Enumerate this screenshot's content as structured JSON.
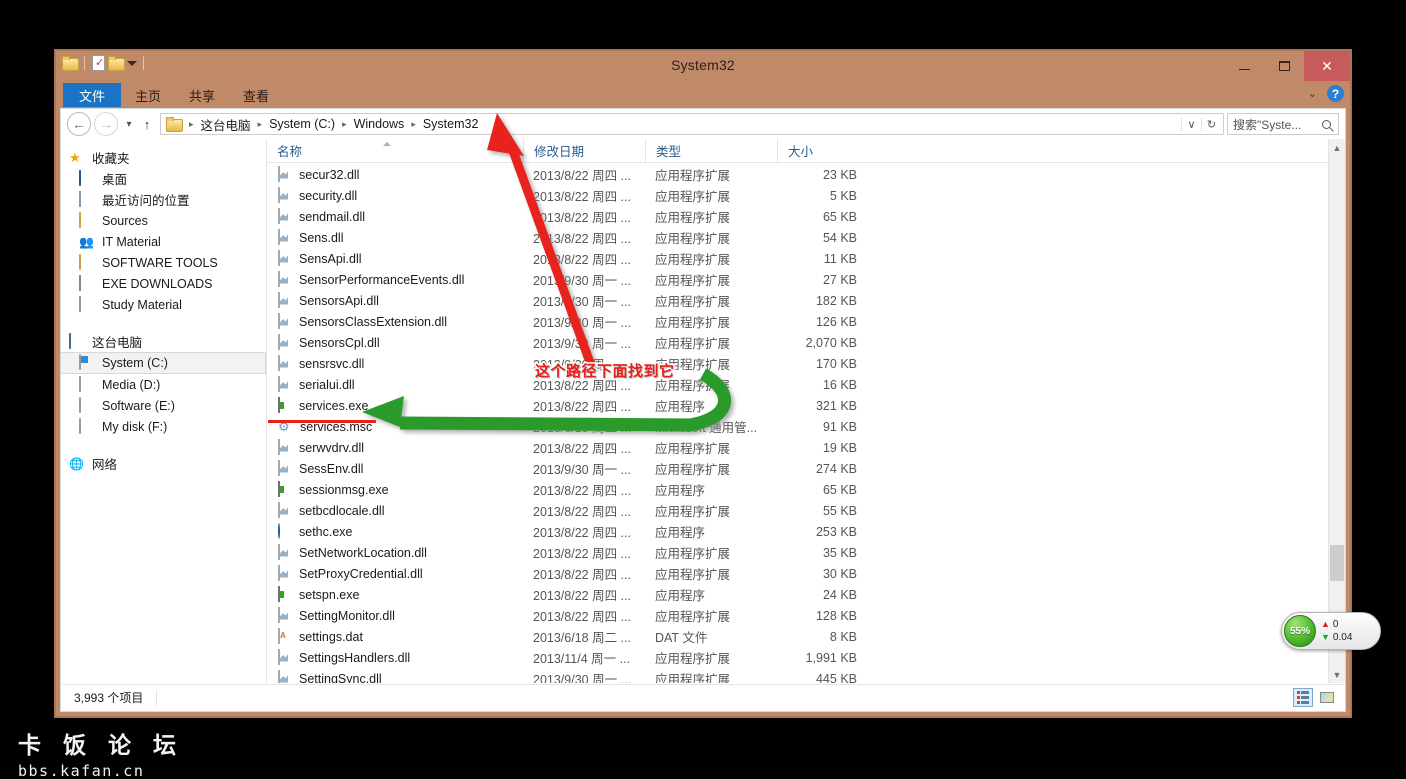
{
  "window": {
    "title": "System32",
    "quick_access": [
      "folder-icon",
      "properties-icon",
      "new-folder-icon",
      "customize-chevron-icon"
    ],
    "controls": {
      "minimize": "minimize-icon",
      "maximize": "maximize-icon",
      "close": "✕"
    }
  },
  "ribbon": {
    "tabs": [
      {
        "label": "文件",
        "active": true
      },
      {
        "label": "主页",
        "active": false
      },
      {
        "label": "共享",
        "active": false
      },
      {
        "label": "查看",
        "active": false
      }
    ],
    "collapse_icon": "chevron-down-icon",
    "help_icon": "?"
  },
  "address": {
    "back": "←",
    "forward": "→",
    "recent": "▾",
    "up": "↑",
    "breadcrumbs": [
      "这台电脑",
      "System (C:)",
      "Windows",
      "System32"
    ],
    "separator": "▸",
    "dropdown": "∨",
    "refresh": "↻",
    "search_value": "搜索\"Syste...",
    "search_placeholder": "搜索\"System32\""
  },
  "sidebar": {
    "groups": [
      {
        "header": {
          "label": "收藏夹",
          "icon": "star-icon"
        },
        "items": [
          {
            "label": "桌面",
            "icon": "desktop-icon",
            "selected": false
          },
          {
            "label": "最近访问的位置",
            "icon": "recent-places-icon",
            "selected": false
          },
          {
            "label": "Sources",
            "icon": "folder-icon",
            "selected": false
          },
          {
            "label": "IT Material",
            "icon": "shared-folder-icon",
            "selected": false
          },
          {
            "label": "SOFTWARE TOOLS",
            "icon": "folder-icon",
            "selected": false
          },
          {
            "label": "EXE DOWNLOADS",
            "icon": "exe-folder-icon",
            "selected": false
          },
          {
            "label": "Study Material",
            "icon": "document-icon",
            "selected": false
          }
        ]
      },
      {
        "header": {
          "label": "这台电脑",
          "icon": "computer-icon"
        },
        "items": [
          {
            "label": "System (C:)",
            "icon": "system-drive-icon",
            "selected": true
          },
          {
            "label": "Media (D:)",
            "icon": "drive-icon",
            "selected": false
          },
          {
            "label": "Software (E:)",
            "icon": "drive-icon",
            "selected": false
          },
          {
            "label": "My disk (F:)",
            "icon": "drive-icon",
            "selected": false
          }
        ]
      },
      {
        "header": {
          "label": "网络",
          "icon": "network-icon"
        },
        "items": []
      }
    ]
  },
  "filelist": {
    "columns": [
      {
        "label": "名称",
        "sorted": "asc"
      },
      {
        "label": "修改日期",
        "sorted": ""
      },
      {
        "label": "类型",
        "sorted": ""
      },
      {
        "label": "大小",
        "sorted": ""
      }
    ],
    "rows": [
      {
        "name": "secur32.dll",
        "date": "2013/8/22 周四 ...",
        "type": "应用程序扩展",
        "size": "23 KB",
        "icon": "dll-icon"
      },
      {
        "name": "security.dll",
        "date": "2013/8/22 周四 ...",
        "type": "应用程序扩展",
        "size": "5 KB",
        "icon": "dll-icon"
      },
      {
        "name": "sendmail.dll",
        "date": "2013/8/22 周四 ...",
        "type": "应用程序扩展",
        "size": "65 KB",
        "icon": "dll-icon"
      },
      {
        "name": "Sens.dll",
        "date": "2013/8/22 周四 ...",
        "type": "应用程序扩展",
        "size": "54 KB",
        "icon": "dll-icon"
      },
      {
        "name": "SensApi.dll",
        "date": "2013/8/22 周四 ...",
        "type": "应用程序扩展",
        "size": "11 KB",
        "icon": "dll-icon"
      },
      {
        "name": "SensorPerformanceEvents.dll",
        "date": "2013/9/30 周一 ...",
        "type": "应用程序扩展",
        "size": "27 KB",
        "icon": "dll-icon"
      },
      {
        "name": "SensorsApi.dll",
        "date": "2013/9/30 周一 ...",
        "type": "应用程序扩展",
        "size": "182 KB",
        "icon": "dll-icon"
      },
      {
        "name": "SensorsClassExtension.dll",
        "date": "2013/9/30 周一 ...",
        "type": "应用程序扩展",
        "size": "126 KB",
        "icon": "dll-icon"
      },
      {
        "name": "SensorsCpl.dll",
        "date": "2013/9/30 周一 ...",
        "type": "应用程序扩展",
        "size": "2,070 KB",
        "icon": "dll-icon"
      },
      {
        "name": "sensrsvc.dll",
        "date": "2013/9/30 周一 ...",
        "type": "应用程序扩展",
        "size": "170 KB",
        "icon": "dll-icon"
      },
      {
        "name": "serialui.dll",
        "date": "2013/8/22 周四 ...",
        "type": "应用程序扩展",
        "size": "16 KB",
        "icon": "dll-icon"
      },
      {
        "name": "services.exe",
        "date": "2013/8/22 周四 ...",
        "type": "应用程序",
        "size": "321 KB",
        "icon": "exe-icon"
      },
      {
        "name": "services.msc",
        "date": "2013/6/18 周二 ...",
        "type": "Microsoft 通用管...",
        "size": "91 KB",
        "icon": "msc-icon"
      },
      {
        "name": "serwvdrv.dll",
        "date": "2013/8/22 周四 ...",
        "type": "应用程序扩展",
        "size": "19 KB",
        "icon": "dll-icon"
      },
      {
        "name": "SessEnv.dll",
        "date": "2013/9/30 周一 ...",
        "type": "应用程序扩展",
        "size": "274 KB",
        "icon": "dll-icon"
      },
      {
        "name": "sessionmsg.exe",
        "date": "2013/8/22 周四 ...",
        "type": "应用程序",
        "size": "65 KB",
        "icon": "exe-icon"
      },
      {
        "name": "setbcdlocale.dll",
        "date": "2013/8/22 周四 ...",
        "type": "应用程序扩展",
        "size": "55 KB",
        "icon": "dll-icon"
      },
      {
        "name": "sethc.exe",
        "date": "2013/8/22 周四 ...",
        "type": "应用程序",
        "size": "253 KB",
        "icon": "sethc-icon"
      },
      {
        "name": "SetNetworkLocation.dll",
        "date": "2013/8/22 周四 ...",
        "type": "应用程序扩展",
        "size": "35 KB",
        "icon": "dll-icon"
      },
      {
        "name": "SetProxyCredential.dll",
        "date": "2013/8/22 周四 ...",
        "type": "应用程序扩展",
        "size": "30 KB",
        "icon": "dll-icon"
      },
      {
        "name": "setspn.exe",
        "date": "2013/8/22 周四 ...",
        "type": "应用程序",
        "size": "24 KB",
        "icon": "exe-icon"
      },
      {
        "name": "SettingMonitor.dll",
        "date": "2013/8/22 周四 ...",
        "type": "应用程序扩展",
        "size": "128 KB",
        "icon": "dll-icon"
      },
      {
        "name": "settings.dat",
        "date": "2013/6/18 周二 ...",
        "type": "DAT 文件",
        "size": "8 KB",
        "icon": "dat-icon"
      },
      {
        "name": "SettingsHandlers.dll",
        "date": "2013/11/4 周一 ...",
        "type": "应用程序扩展",
        "size": "1,991 KB",
        "icon": "dll-icon"
      },
      {
        "name": "SettingSync.dll",
        "date": "2013/9/30 周一 ...",
        "type": "应用程序扩展",
        "size": "445 KB",
        "icon": "dll-icon"
      }
    ]
  },
  "statusbar": {
    "count": "3,993 个项目",
    "view_details_icon": "details-view-icon",
    "view_tiles_icon": "tiles-view-icon"
  },
  "annotation": {
    "text": "这个路径下面找到它",
    "red_color": "#e8201a",
    "green_color": "#2a9b2a",
    "red_arrow_target": "System32",
    "green_arrow_target": "services.exe"
  },
  "watermark": {
    "cn": "卡 饭 论 坛",
    "en": "bbs.kafan.cn"
  },
  "perf_widget": {
    "percent": "55%",
    "upload": "0",
    "download": "0.04",
    "up_icon": "arrow-up-icon",
    "down_icon": "arrow-down-icon"
  }
}
